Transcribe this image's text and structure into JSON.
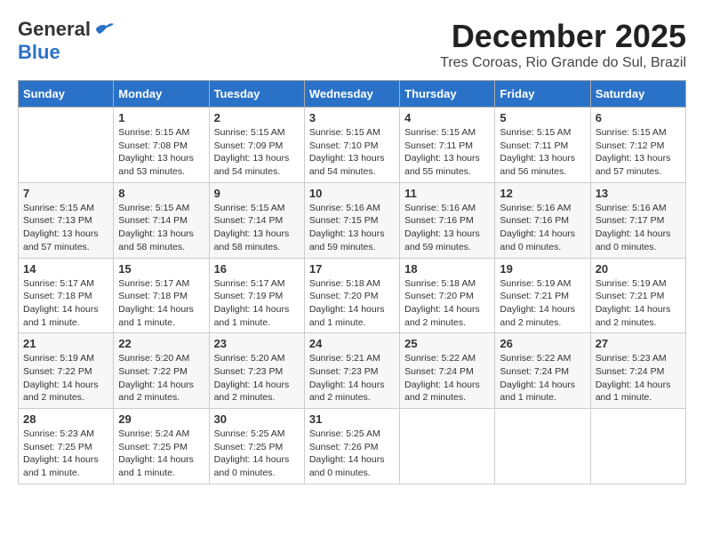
{
  "header": {
    "logo_line1": "General",
    "logo_line2": "Blue",
    "month": "December 2025",
    "location": "Tres Coroas, Rio Grande do Sul, Brazil"
  },
  "weekdays": [
    "Sunday",
    "Monday",
    "Tuesday",
    "Wednesday",
    "Thursday",
    "Friday",
    "Saturday"
  ],
  "weeks": [
    [
      {
        "day": "",
        "info": ""
      },
      {
        "day": "1",
        "info": "Sunrise: 5:15 AM\nSunset: 7:08 PM\nDaylight: 13 hours\nand 53 minutes."
      },
      {
        "day": "2",
        "info": "Sunrise: 5:15 AM\nSunset: 7:09 PM\nDaylight: 13 hours\nand 54 minutes."
      },
      {
        "day": "3",
        "info": "Sunrise: 5:15 AM\nSunset: 7:10 PM\nDaylight: 13 hours\nand 54 minutes."
      },
      {
        "day": "4",
        "info": "Sunrise: 5:15 AM\nSunset: 7:11 PM\nDaylight: 13 hours\nand 55 minutes."
      },
      {
        "day": "5",
        "info": "Sunrise: 5:15 AM\nSunset: 7:11 PM\nDaylight: 13 hours\nand 56 minutes."
      },
      {
        "day": "6",
        "info": "Sunrise: 5:15 AM\nSunset: 7:12 PM\nDaylight: 13 hours\nand 57 minutes."
      }
    ],
    [
      {
        "day": "7",
        "info": "Sunrise: 5:15 AM\nSunset: 7:13 PM\nDaylight: 13 hours\nand 57 minutes."
      },
      {
        "day": "8",
        "info": "Sunrise: 5:15 AM\nSunset: 7:14 PM\nDaylight: 13 hours\nand 58 minutes."
      },
      {
        "day": "9",
        "info": "Sunrise: 5:15 AM\nSunset: 7:14 PM\nDaylight: 13 hours\nand 58 minutes."
      },
      {
        "day": "10",
        "info": "Sunrise: 5:16 AM\nSunset: 7:15 PM\nDaylight: 13 hours\nand 59 minutes."
      },
      {
        "day": "11",
        "info": "Sunrise: 5:16 AM\nSunset: 7:16 PM\nDaylight: 13 hours\nand 59 minutes."
      },
      {
        "day": "12",
        "info": "Sunrise: 5:16 AM\nSunset: 7:16 PM\nDaylight: 14 hours\nand 0 minutes."
      },
      {
        "day": "13",
        "info": "Sunrise: 5:16 AM\nSunset: 7:17 PM\nDaylight: 14 hours\nand 0 minutes."
      }
    ],
    [
      {
        "day": "14",
        "info": "Sunrise: 5:17 AM\nSunset: 7:18 PM\nDaylight: 14 hours\nand 1 minute."
      },
      {
        "day": "15",
        "info": "Sunrise: 5:17 AM\nSunset: 7:18 PM\nDaylight: 14 hours\nand 1 minute."
      },
      {
        "day": "16",
        "info": "Sunrise: 5:17 AM\nSunset: 7:19 PM\nDaylight: 14 hours\nand 1 minute."
      },
      {
        "day": "17",
        "info": "Sunrise: 5:18 AM\nSunset: 7:20 PM\nDaylight: 14 hours\nand 1 minute."
      },
      {
        "day": "18",
        "info": "Sunrise: 5:18 AM\nSunset: 7:20 PM\nDaylight: 14 hours\nand 2 minutes."
      },
      {
        "day": "19",
        "info": "Sunrise: 5:19 AM\nSunset: 7:21 PM\nDaylight: 14 hours\nand 2 minutes."
      },
      {
        "day": "20",
        "info": "Sunrise: 5:19 AM\nSunset: 7:21 PM\nDaylight: 14 hours\nand 2 minutes."
      }
    ],
    [
      {
        "day": "21",
        "info": "Sunrise: 5:19 AM\nSunset: 7:22 PM\nDaylight: 14 hours\nand 2 minutes."
      },
      {
        "day": "22",
        "info": "Sunrise: 5:20 AM\nSunset: 7:22 PM\nDaylight: 14 hours\nand 2 minutes."
      },
      {
        "day": "23",
        "info": "Sunrise: 5:20 AM\nSunset: 7:23 PM\nDaylight: 14 hours\nand 2 minutes."
      },
      {
        "day": "24",
        "info": "Sunrise: 5:21 AM\nSunset: 7:23 PM\nDaylight: 14 hours\nand 2 minutes."
      },
      {
        "day": "25",
        "info": "Sunrise: 5:22 AM\nSunset: 7:24 PM\nDaylight: 14 hours\nand 2 minutes."
      },
      {
        "day": "26",
        "info": "Sunrise: 5:22 AM\nSunset: 7:24 PM\nDaylight: 14 hours\nand 1 minute."
      },
      {
        "day": "27",
        "info": "Sunrise: 5:23 AM\nSunset: 7:24 PM\nDaylight: 14 hours\nand 1 minute."
      }
    ],
    [
      {
        "day": "28",
        "info": "Sunrise: 5:23 AM\nSunset: 7:25 PM\nDaylight: 14 hours\nand 1 minute."
      },
      {
        "day": "29",
        "info": "Sunrise: 5:24 AM\nSunset: 7:25 PM\nDaylight: 14 hours\nand 1 minute."
      },
      {
        "day": "30",
        "info": "Sunrise: 5:25 AM\nSunset: 7:25 PM\nDaylight: 14 hours\nand 0 minutes."
      },
      {
        "day": "31",
        "info": "Sunrise: 5:25 AM\nSunset: 7:26 PM\nDaylight: 14 hours\nand 0 minutes."
      },
      {
        "day": "",
        "info": ""
      },
      {
        "day": "",
        "info": ""
      },
      {
        "day": "",
        "info": ""
      }
    ]
  ]
}
